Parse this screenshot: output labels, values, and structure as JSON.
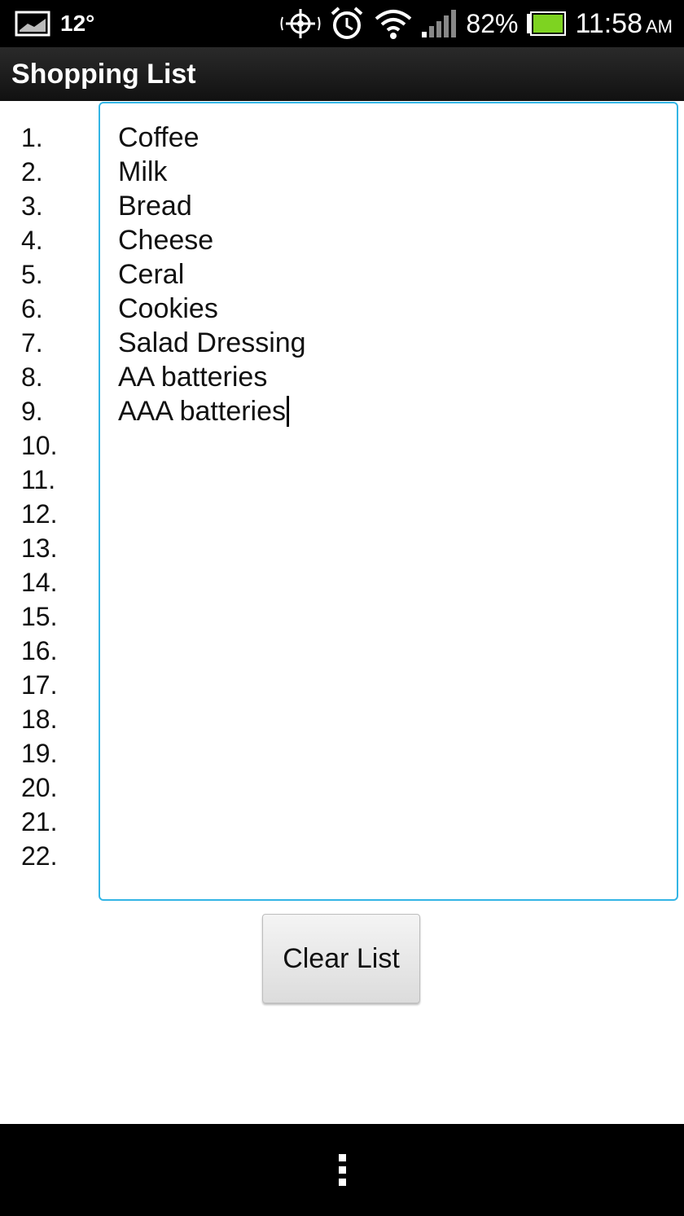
{
  "status_bar": {
    "weather_temp": "12°",
    "battery_percent": "82%",
    "time": "11:58",
    "ampm": "AM",
    "icons": [
      "weather-icon",
      "gps-icon",
      "alarm-icon",
      "wifi-icon",
      "signal-icon",
      "battery-icon"
    ],
    "battery_color": "#7ed321"
  },
  "action_bar": {
    "title": "Shopping List"
  },
  "line_numbers": [
    "1.",
    "2.",
    "3.",
    "4.",
    "5.",
    "6.",
    "7.",
    "8.",
    "9.",
    "10.",
    "11.",
    "12.",
    "13.",
    "14.",
    "15.",
    "16.",
    "17.",
    "18.",
    "19.",
    "20.",
    "21.",
    "22."
  ],
  "editor": {
    "lines": [
      "Coffee",
      "Milk",
      "Bread",
      "Cheese",
      "Ceral",
      "Cookies",
      "Salad Dressing",
      "AA batteries",
      "AAA batteries"
    ],
    "accent_color": "#33b5e5"
  },
  "clear_button": {
    "label": "Clear List"
  },
  "nav_bar": {
    "icon": "menu-overflow-icon"
  }
}
